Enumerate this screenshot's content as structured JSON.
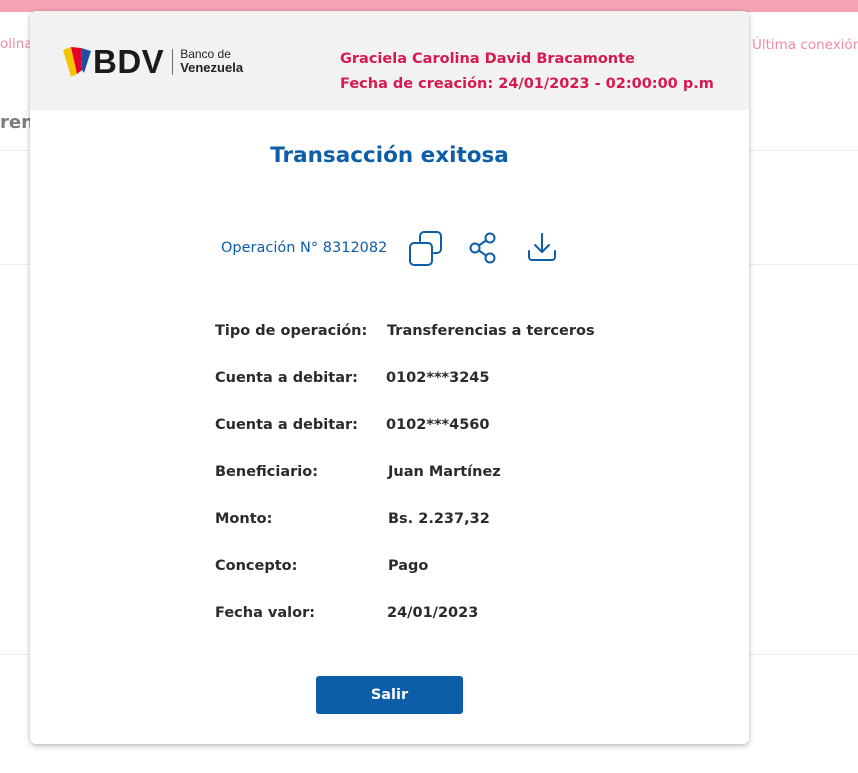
{
  "background": {
    "header_left_text": "olina",
    "header_right_text": "Última conexión",
    "page_title_fragment": "ren"
  },
  "modal": {
    "bank_logo": {
      "wordmark": "BDV",
      "line1": "Banco de",
      "line2": "Venezuela"
    },
    "user_name": "Graciela Carolina David Bracamonte",
    "created_at": "Fecha de creación: 24/01/2023 - 02:00:00 p.m",
    "result_title": "Transacción exitosa",
    "operation_label": "Operación N° 8312082",
    "actions": [
      {
        "icon": "copy-icon"
      },
      {
        "icon": "share-icon"
      },
      {
        "icon": "download-icon"
      }
    ],
    "details": [
      {
        "label": "Tipo de operación:",
        "value": "Transferencias a terceros"
      },
      {
        "label": "Cuenta a debitar:",
        "value": "0102***3245"
      },
      {
        "label": "Cuenta a debitar:",
        "value": "0102***4560"
      },
      {
        "label": "Beneficiario:",
        "value": "Juan Martínez"
      },
      {
        "label": "Monto:",
        "value": "Bs. 2.237,32"
      },
      {
        "label": "Concepto:",
        "value": "Pago"
      },
      {
        "label": "Fecha valor:",
        "value": "24/01/2023"
      }
    ],
    "exit_button": "Salir"
  },
  "colors": {
    "brand_blue": "#0c5ea8",
    "accent_red": "#d61a4f",
    "top_bar_pink": "#f3a3b5",
    "header_gray": "#f2f2f2"
  }
}
